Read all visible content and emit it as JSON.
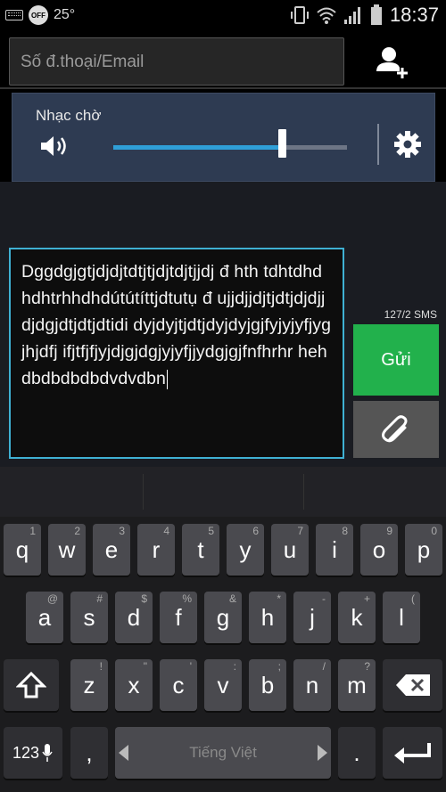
{
  "status": {
    "temperature": "25°",
    "time": "18:37",
    "off_label": "OFF"
  },
  "topbar": {
    "to_placeholder": "Số đ.thoại/Email"
  },
  "volume": {
    "label": "Nhạc chờ",
    "level": 0.72
  },
  "compose": {
    "message": "Dggdgjgtjdjdjtdtjtjdjtdjtjjdj đ hth tdhtdhdhdhtrhhdhdútútíttjdtutụ đ ujjdjjdjtjdtjdjdjjdjdgjdtjdtjdtidi dyjdyjtjdtjdyjdyjgjfyjyjyfjygjhjdfj ifjtfjfjyjdjgjdgjyjyfjjydgjgjfnfhrhr hehdbdbdbdbdvdvdbn",
    "counter": "127/2  SMS",
    "send_label": "Gửi"
  },
  "keyboard": {
    "row1": [
      {
        "k": "q",
        "h": "1"
      },
      {
        "k": "w",
        "h": "2"
      },
      {
        "k": "e",
        "h": "3"
      },
      {
        "k": "r",
        "h": "4"
      },
      {
        "k": "t",
        "h": "5"
      },
      {
        "k": "y",
        "h": "6"
      },
      {
        "k": "u",
        "h": "7"
      },
      {
        "k": "i",
        "h": "8"
      },
      {
        "k": "o",
        "h": "9"
      },
      {
        "k": "p",
        "h": "0"
      }
    ],
    "row2": [
      {
        "k": "a",
        "h": "@"
      },
      {
        "k": "s",
        "h": "#"
      },
      {
        "k": "d",
        "h": "$"
      },
      {
        "k": "f",
        "h": "%"
      },
      {
        "k": "g",
        "h": "&"
      },
      {
        "k": "h",
        "h": "*"
      },
      {
        "k": "j",
        "h": "-"
      },
      {
        "k": "k",
        "h": "+"
      },
      {
        "k": "l",
        "h": "("
      }
    ],
    "row3": [
      {
        "k": "z",
        "h": "!"
      },
      {
        "k": "x",
        "h": "\""
      },
      {
        "k": "c",
        "h": "'"
      },
      {
        "k": "v",
        "h": ":"
      },
      {
        "k": "b",
        "h": ";"
      },
      {
        "k": "n",
        "h": "/"
      },
      {
        "k": "m",
        "h": "?"
      }
    ],
    "num_label": "123",
    "comma": ",",
    "space_label": "Tiếng Việt",
    "period": "."
  }
}
